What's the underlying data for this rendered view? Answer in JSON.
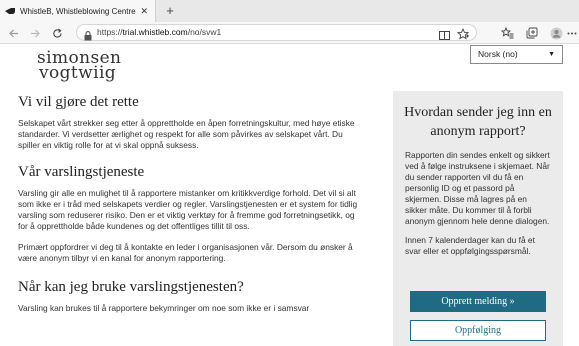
{
  "browser": {
    "tab_title": "WhistleB, Whistleblowing Centre",
    "tab_close": "✕",
    "new_tab": "+",
    "url_prefix": "https://",
    "url_host": "trial.whistleb.com",
    "url_path": "/no/svw1"
  },
  "header": {
    "logo_line1": "simonsen",
    "logo_line2": "vogtwiig",
    "language": "Norsk (no)"
  },
  "main": {
    "sections": [
      {
        "heading": "Vi vil gjøre det rette",
        "paragraphs": [
          "Selskapet vårt strekker seg etter å opprettholde en åpen forretningskultur, med høye etiske standarder. Vi verdsetter ærlighet og respekt for alle som påvirkes av selskapet vårt. Du spiller en viktig rolle for at vi skal oppnå suksess."
        ]
      },
      {
        "heading": "Vår varslingstjeneste",
        "paragraphs": [
          "Varsling gir alle en mulighet til å rapportere mistanker om kritikkverdige forhold. Det vil si alt som ikke er i tråd med selskapets verdier og regler. Varslingstjenesten er et system for tidlig varsling som reduserer risiko. Den er et viktig verktøy for å fremme god forretningsetikk, og for å opprettholde både kundenes og det offentliges tillit til oss.",
          "Primært oppfordrer vi deg til å kontakte en leder i organisasjonen vår. Dersom du ønsker å være anonym tilbyr vi en kanal for anonym rapportering."
        ]
      },
      {
        "heading": "Når kan jeg bruke varslingstjenesten?",
        "paragraphs": [
          "Varsling kan brukes til å rapportere bekymringer om noe som ikke er i samsvar"
        ]
      }
    ]
  },
  "sidebar": {
    "heading": "Hvordan sender jeg inn en anonym rapport?",
    "paragraph1": "Rapporten din sendes enkelt og sikkert ved å følge instruksene i skjemaet. Når du sender rapporten vil du få en personlig ID og et passord på skjermen. Disse må lagres på en sikker måte. Du kommer til å forbli anonym gjennom hele denne dialogen.",
    "paragraph2": "Innen 7 kalenderdager kan du få et svar eller et oppfølgingsspørsmål.",
    "primary_button": "Opprett melding »",
    "secondary_button": "Oppfølging"
  },
  "icons": {
    "favicon": "whistle-icon",
    "back": "back-arrow-icon",
    "forward": "forward-arrow-icon",
    "reload": "reload-icon",
    "lock": "lock-icon",
    "reader": "reader-view-icon",
    "favorite": "favorite-star-icon",
    "favorites_bar": "favorites-bar-icon",
    "collections": "collections-icon",
    "profile": "profile-icon",
    "menu": "more-menu-icon"
  },
  "colors": {
    "accent": "#1f6b84",
    "sidebar_bg": "#ebebeb"
  }
}
